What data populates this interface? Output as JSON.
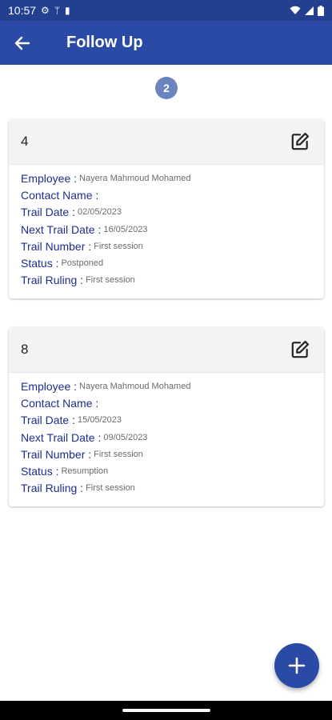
{
  "status_bar": {
    "time": "10:57",
    "icons": [
      "settings-icon",
      "usb-icon",
      "sim-icon",
      "wifi-icon",
      "signal-icon",
      "battery-icon"
    ]
  },
  "app_bar": {
    "title": "Follow Up",
    "back_icon": "arrow-left-icon"
  },
  "page_badge": "2",
  "labels": {
    "employee": "Employee :",
    "contact_name": "Contact Name :",
    "trail_date": "Trail Date :",
    "next_trail_date": "Next Trail Date :",
    "trail_number": "Trail Number :",
    "status": "Status :",
    "trail_ruling": "Trail Ruling :"
  },
  "cards": [
    {
      "id": "4",
      "employee": "Nayera Mahmoud Mohamed",
      "contact_name": "",
      "trail_date": "02/05/2023",
      "next_trail_date": "16/05/2023",
      "trail_number": "First session",
      "status": "Postponed",
      "trail_ruling": "First session"
    },
    {
      "id": "8",
      "employee": "Nayera Mahmoud Mohamed",
      "contact_name": "",
      "trail_date": "15/05/2023",
      "next_trail_date": "09/05/2023",
      "trail_number": "First session",
      "status": "Resumption",
      "trail_ruling": "First session"
    }
  ],
  "colors": {
    "primary": "#2a4aa5",
    "status_bar": "#233f8f",
    "label": "#1d2e8c",
    "badge": "#6a84c0"
  }
}
